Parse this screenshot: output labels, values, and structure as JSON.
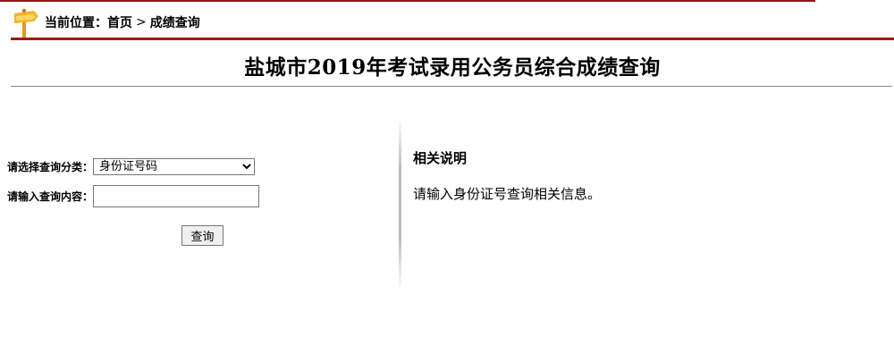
{
  "breadcrumb": {
    "prefix": "当前位置：",
    "home": "首页",
    "separator": ">",
    "current": "成绩查询"
  },
  "page_title": "盐城市2019年考试录用公务员综合成绩查询",
  "form": {
    "type_label": "请选择查询分类：",
    "type_selected": "身份证号码",
    "content_label": "请输入查询内容：",
    "content_value": "",
    "submit_label": "查询"
  },
  "info": {
    "title": "相关说明",
    "text": "请输入身份证号查询相关信息。"
  },
  "colors": {
    "accent_rule": "#a31515",
    "top_rule": "#8b1a1a",
    "sign_icon": "#f0a81e"
  }
}
